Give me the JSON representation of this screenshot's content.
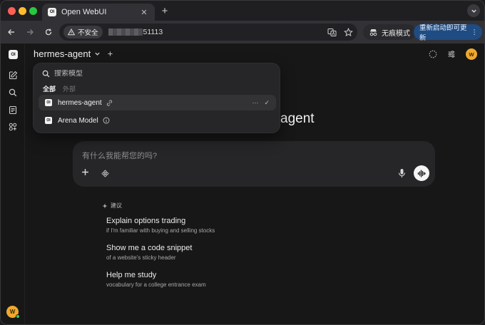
{
  "browser": {
    "tab_title": "Open WebUI",
    "tab_close": "✕",
    "new_tab": "+",
    "insecure_label": "不安全",
    "url_suffix": "51113",
    "incognito_label": "无痕模式",
    "update_label": "重新启动即可更新",
    "update_menu": "⋮"
  },
  "app": {
    "logo": "OI",
    "current_model": "hermes-agent",
    "user_initial": "W",
    "background_title": "agent",
    "chat": {
      "placeholder": "有什么我能帮您的吗?"
    },
    "suggestions_label": "建议",
    "suggestions": [
      {
        "title": "Explain options trading",
        "subtitle": "if I'm familiar with buying and selling stocks"
      },
      {
        "title": "Show me a code snippet",
        "subtitle": "of a website's sticky header"
      },
      {
        "title": "Help me study",
        "subtitle": "vocabulary for a college entrance exam"
      }
    ]
  },
  "model_dropdown": {
    "search_placeholder": "搜索模型",
    "tabs": [
      "全部",
      "外部"
    ],
    "items": [
      {
        "label": "hermes-agent",
        "more": "···",
        "check": "✓"
      },
      {
        "label": "Arena Model"
      }
    ]
  }
}
